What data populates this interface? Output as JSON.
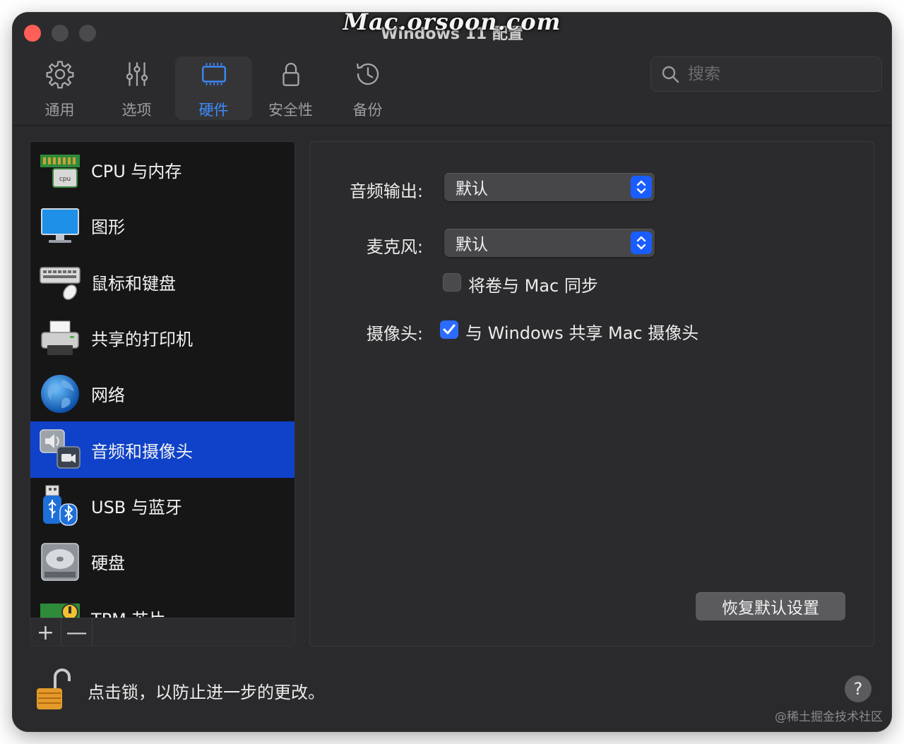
{
  "window": {
    "title": "Windows 11 配置",
    "watermark_top": "Mac.orsoon.com",
    "watermark_bottom": "@稀土掘金技术社区"
  },
  "toolbar": {
    "items": [
      {
        "label": "通用",
        "icon": "gear-icon"
      },
      {
        "label": "选项",
        "icon": "sliders-icon"
      },
      {
        "label": "硬件",
        "icon": "chip-icon",
        "active": true
      },
      {
        "label": "安全性",
        "icon": "lock-icon"
      },
      {
        "label": "备份",
        "icon": "history-clock-icon"
      }
    ],
    "active_color": "#3d8cff"
  },
  "search": {
    "placeholder": "搜索"
  },
  "sidebar": {
    "items": [
      {
        "label": "CPU 与内存",
        "icon": "cpu-memory-icon"
      },
      {
        "label": "图形",
        "icon": "monitor-icon"
      },
      {
        "label": "鼠标和键盘",
        "icon": "keyboard-mouse-icon"
      },
      {
        "label": "共享的打印机",
        "icon": "printer-icon"
      },
      {
        "label": "网络",
        "icon": "globe-icon"
      },
      {
        "label": "音频和摄像头",
        "icon": "speaker-camera-icon",
        "selected": true
      },
      {
        "label": "USB 与蓝牙",
        "icon": "usb-bluetooth-icon"
      },
      {
        "label": "硬盘",
        "icon": "hard-disk-icon"
      },
      {
        "label": "TPM 芯片",
        "icon": "tpm-chip-icon"
      }
    ],
    "add_label": "+",
    "remove_label": "—",
    "selected_color": "#0f42c8"
  },
  "panel": {
    "audio_output": {
      "label": "音频输出:",
      "value": "默认"
    },
    "microphone": {
      "label": "麦克风:",
      "value": "默认"
    },
    "sync_volume": {
      "label": "将卷与 Mac 同步",
      "checked": false
    },
    "camera": {
      "label": "摄像头:",
      "option_label": "与 Windows 共享 Mac 摄像头",
      "checked": true
    },
    "restore_button": "恢复默认设置"
  },
  "bottom": {
    "lock_text": "点击锁，以防止进一步的更改。",
    "help_label": "?"
  }
}
